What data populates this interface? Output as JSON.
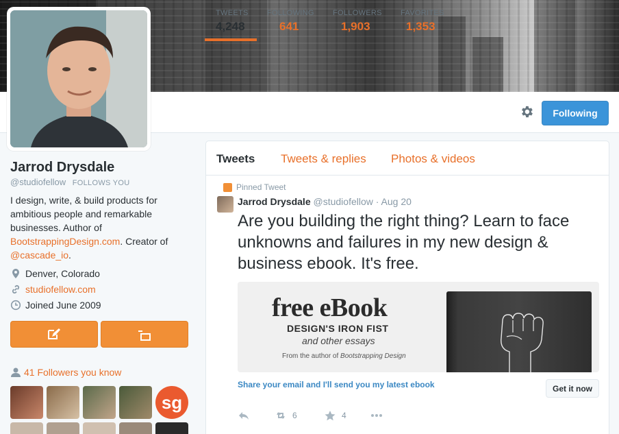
{
  "profile": {
    "name": "Jarrod Drysdale",
    "handle": "@studiofellow",
    "follows_you": "FOLLOWS YOU",
    "bio_1": "I design, write, & build products for ambitious people and remarkable businesses. Author of ",
    "bio_link_1": "BootstrappingDesign.com",
    "bio_2": ". Creator of ",
    "bio_link_2": "@cascade_io",
    "bio_3": ".",
    "location": "Denver, Colorado",
    "website": "studiofellow.com",
    "joined": "Joined June 2009",
    "followers_you_know": "41 Followers you know"
  },
  "nav": {
    "stats": [
      {
        "label": "TWEETS",
        "value": "4,248"
      },
      {
        "label": "FOLLOWING",
        "value": "641"
      },
      {
        "label": "FOLLOWERS",
        "value": "1,903"
      },
      {
        "label": "FAVORITES",
        "value": "1,353"
      }
    ],
    "following_button": "Following"
  },
  "timeline": {
    "tabs": [
      "Tweets",
      "Tweets & replies",
      "Photos & videos"
    ],
    "pinned_label": "Pinned Tweet",
    "tweet": {
      "author": "Jarrod Drysdale",
      "handle": "@studiofellow",
      "date": "· Aug 20",
      "text": "Are you building the right thing? Learn to face unknowns and failures in my new design & business ebook. It's free.",
      "card": {
        "title": "free eBook",
        "subtitle": "DESIGN'S IRON FIST",
        "essays": "and other essays",
        "from": "From the author of ",
        "from_book": "Bootstrapping Design",
        "cta_text": "Share your email and I'll send you my latest ebook",
        "cta_button": "Get it now"
      },
      "retweets": "6",
      "favorites": "4"
    }
  },
  "colors": {
    "accent": "#e8702a",
    "button_orange": "#f18f36",
    "follow_blue": "#3b94d9",
    "link_blue": "#3b88c3"
  }
}
